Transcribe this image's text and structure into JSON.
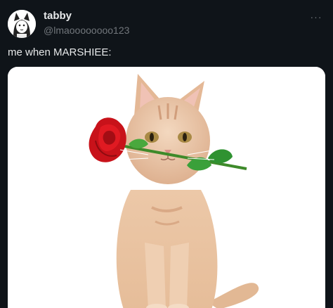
{
  "tweet": {
    "display_name": "tabby",
    "handle": "@lmaoooooooo123",
    "text": "me when MARSHIEE:",
    "more_icon": "more-horizontal-icon",
    "more_glyph": "···"
  },
  "avatar": {
    "icon": "cartoon-cat-avatar"
  },
  "media": {
    "subject": "cat-with-rose-image"
  },
  "colors": {
    "background": "#0f1419",
    "text_primary": "#e7e9ea",
    "text_secondary": "#71767b",
    "media_background": "#ffffff"
  }
}
